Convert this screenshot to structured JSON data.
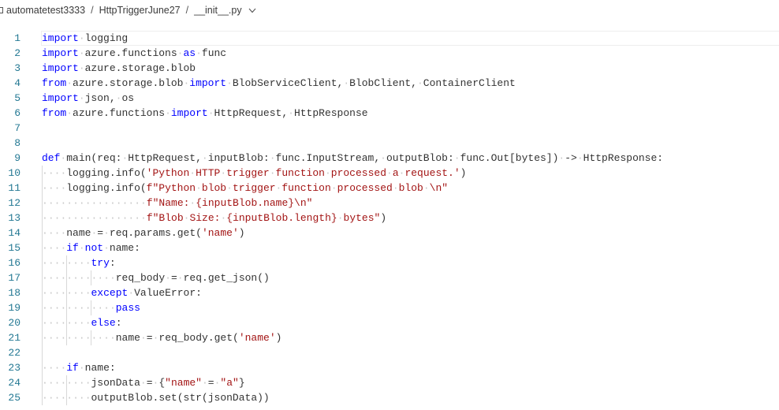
{
  "breadcrumb": {
    "items": [
      "automatetest3333",
      "HttpTriggerJune27",
      "__init__.py"
    ],
    "separator": "/"
  },
  "icons": {
    "file": "file-icon",
    "chevron": "chevron-down-icon"
  },
  "colors": {
    "keyword": "#0000ff",
    "string": "#a31515",
    "line_number": "#237893",
    "text": "#333333"
  },
  "code": {
    "lines": [
      "import logging",
      "import azure.functions as func",
      "import azure.storage.blob",
      "from azure.storage.blob import BlobServiceClient, BlobClient, ContainerClient",
      "import json, os",
      "from azure.functions import HttpRequest, HttpResponse",
      "",
      "",
      "def main(req: HttpRequest, inputBlob: func.InputStream, outputBlob: func.Out[bytes]) -> HttpResponse:",
      "    logging.info('Python HTTP trigger function processed a request.')",
      "    logging.info(f\"Python blob trigger function processed blob \\n\"",
      "                 f\"Name: {inputBlob.name}\\n\"",
      "                 f\"Blob Size: {inputBlob.length} bytes\")",
      "    name = req.params.get('name')",
      "    if not name:",
      "        try:",
      "            req_body = req.get_json()",
      "        except ValueError:",
      "            pass",
      "        else:",
      "            name = req_body.get('name')",
      "",
      "    if name:",
      "        jsonData = {\"name\" = \"a\"}",
      "        outputBlob.set(str(jsonData))"
    ]
  }
}
